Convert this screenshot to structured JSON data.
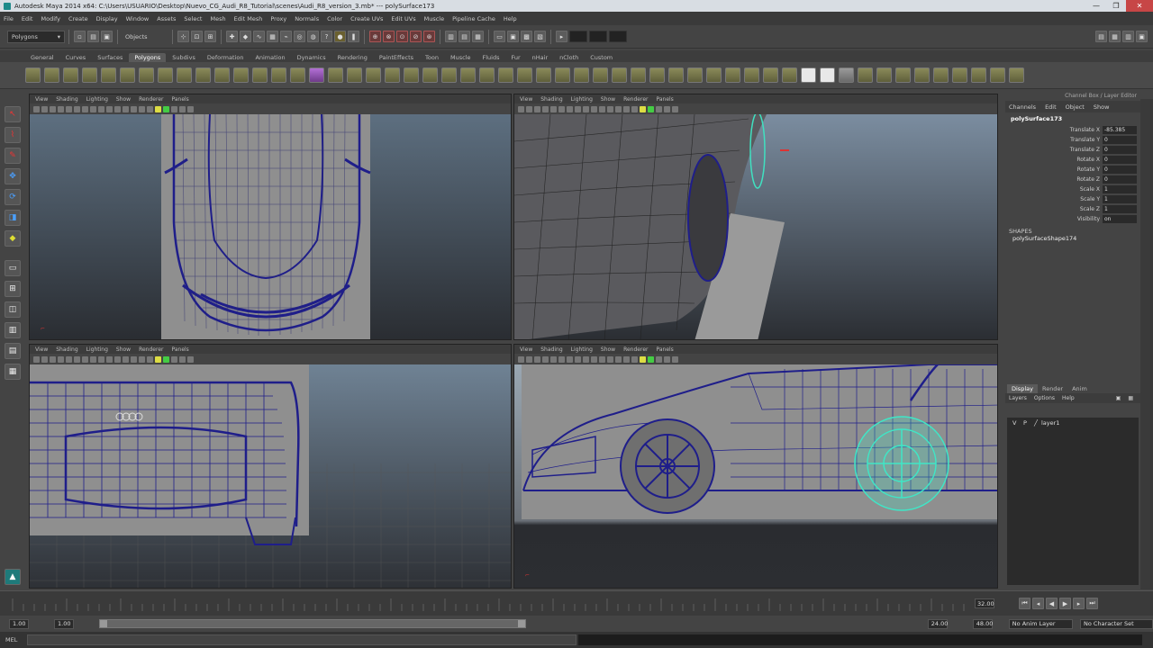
{
  "window": {
    "title": "Autodesk Maya 2014 x64: C:\\Users\\USUARIO\\Desktop\\Nuevo_CG_Audi_R8_Tutorial\\scenes\\Audi_R8_version_3.mb*  ---  polySurface173",
    "minimize": "—",
    "maximize": "❐",
    "close": "✕"
  },
  "menubar": [
    "File",
    "Edit",
    "Modify",
    "Create",
    "Display",
    "Window",
    "Assets",
    "Select",
    "Mesh",
    "Edit Mesh",
    "Proxy",
    "Normals",
    "Color",
    "Create UVs",
    "Edit UVs",
    "Muscle",
    "Pipeline Cache",
    "Help"
  ],
  "statusline": {
    "menuset": "Polygons",
    "objects_label": "Objects"
  },
  "shelf_tabs": [
    {
      "label": "General",
      "active": false
    },
    {
      "label": "Curves",
      "active": false
    },
    {
      "label": "Surfaces",
      "active": false
    },
    {
      "label": "Polygons",
      "active": true
    },
    {
      "label": "Subdivs",
      "active": false
    },
    {
      "label": "Deformation",
      "active": false
    },
    {
      "label": "Animation",
      "active": false
    },
    {
      "label": "Dynamics",
      "active": false
    },
    {
      "label": "Rendering",
      "active": false
    },
    {
      "label": "PaintEffects",
      "active": false
    },
    {
      "label": "Toon",
      "active": false
    },
    {
      "label": "Muscle",
      "active": false
    },
    {
      "label": "Fluids",
      "active": false
    },
    {
      "label": "Fur",
      "active": false
    },
    {
      "label": "nHair",
      "active": false
    },
    {
      "label": "nCloth",
      "active": false
    },
    {
      "label": "Custom",
      "active": false
    }
  ],
  "viewport_menu": [
    "View",
    "Shading",
    "Lighting",
    "Show",
    "Renderer",
    "Panels"
  ],
  "channel_box": {
    "header": "Channel Box / Layer Editor",
    "menu": [
      "Channels",
      "Edit",
      "Object",
      "Show"
    ],
    "object": "polySurface173",
    "attributes": [
      {
        "label": "Translate X",
        "value": "-85.385"
      },
      {
        "label": "Translate Y",
        "value": "0"
      },
      {
        "label": "Translate Z",
        "value": "0"
      },
      {
        "label": "Rotate X",
        "value": "0"
      },
      {
        "label": "Rotate Y",
        "value": "0"
      },
      {
        "label": "Rotate Z",
        "value": "0"
      },
      {
        "label": "Scale X",
        "value": "1"
      },
      {
        "label": "Scale Y",
        "value": "1"
      },
      {
        "label": "Scale Z",
        "value": "1"
      },
      {
        "label": "Visibility",
        "value": "on"
      }
    ],
    "shapes_label": "SHAPES",
    "shape_name": "polySurfaceShape174"
  },
  "layer_editor": {
    "tabs": [
      {
        "label": "Display",
        "active": true
      },
      {
        "label": "Render",
        "active": false
      },
      {
        "label": "Anim",
        "active": false
      }
    ],
    "menu": [
      "Layers",
      "Options",
      "Help"
    ],
    "layers": [
      {
        "v": "V",
        "p": "P",
        "name": "layer1"
      }
    ]
  },
  "timeline": {
    "current_frame": "32.00"
  },
  "range": {
    "start": "1.00",
    "start2": "1.00",
    "end": "24.00",
    "end2": "48.00",
    "anim_layer": "No Anim Layer",
    "char_set": "No Character Set"
  },
  "command_line": {
    "label": "MEL"
  }
}
